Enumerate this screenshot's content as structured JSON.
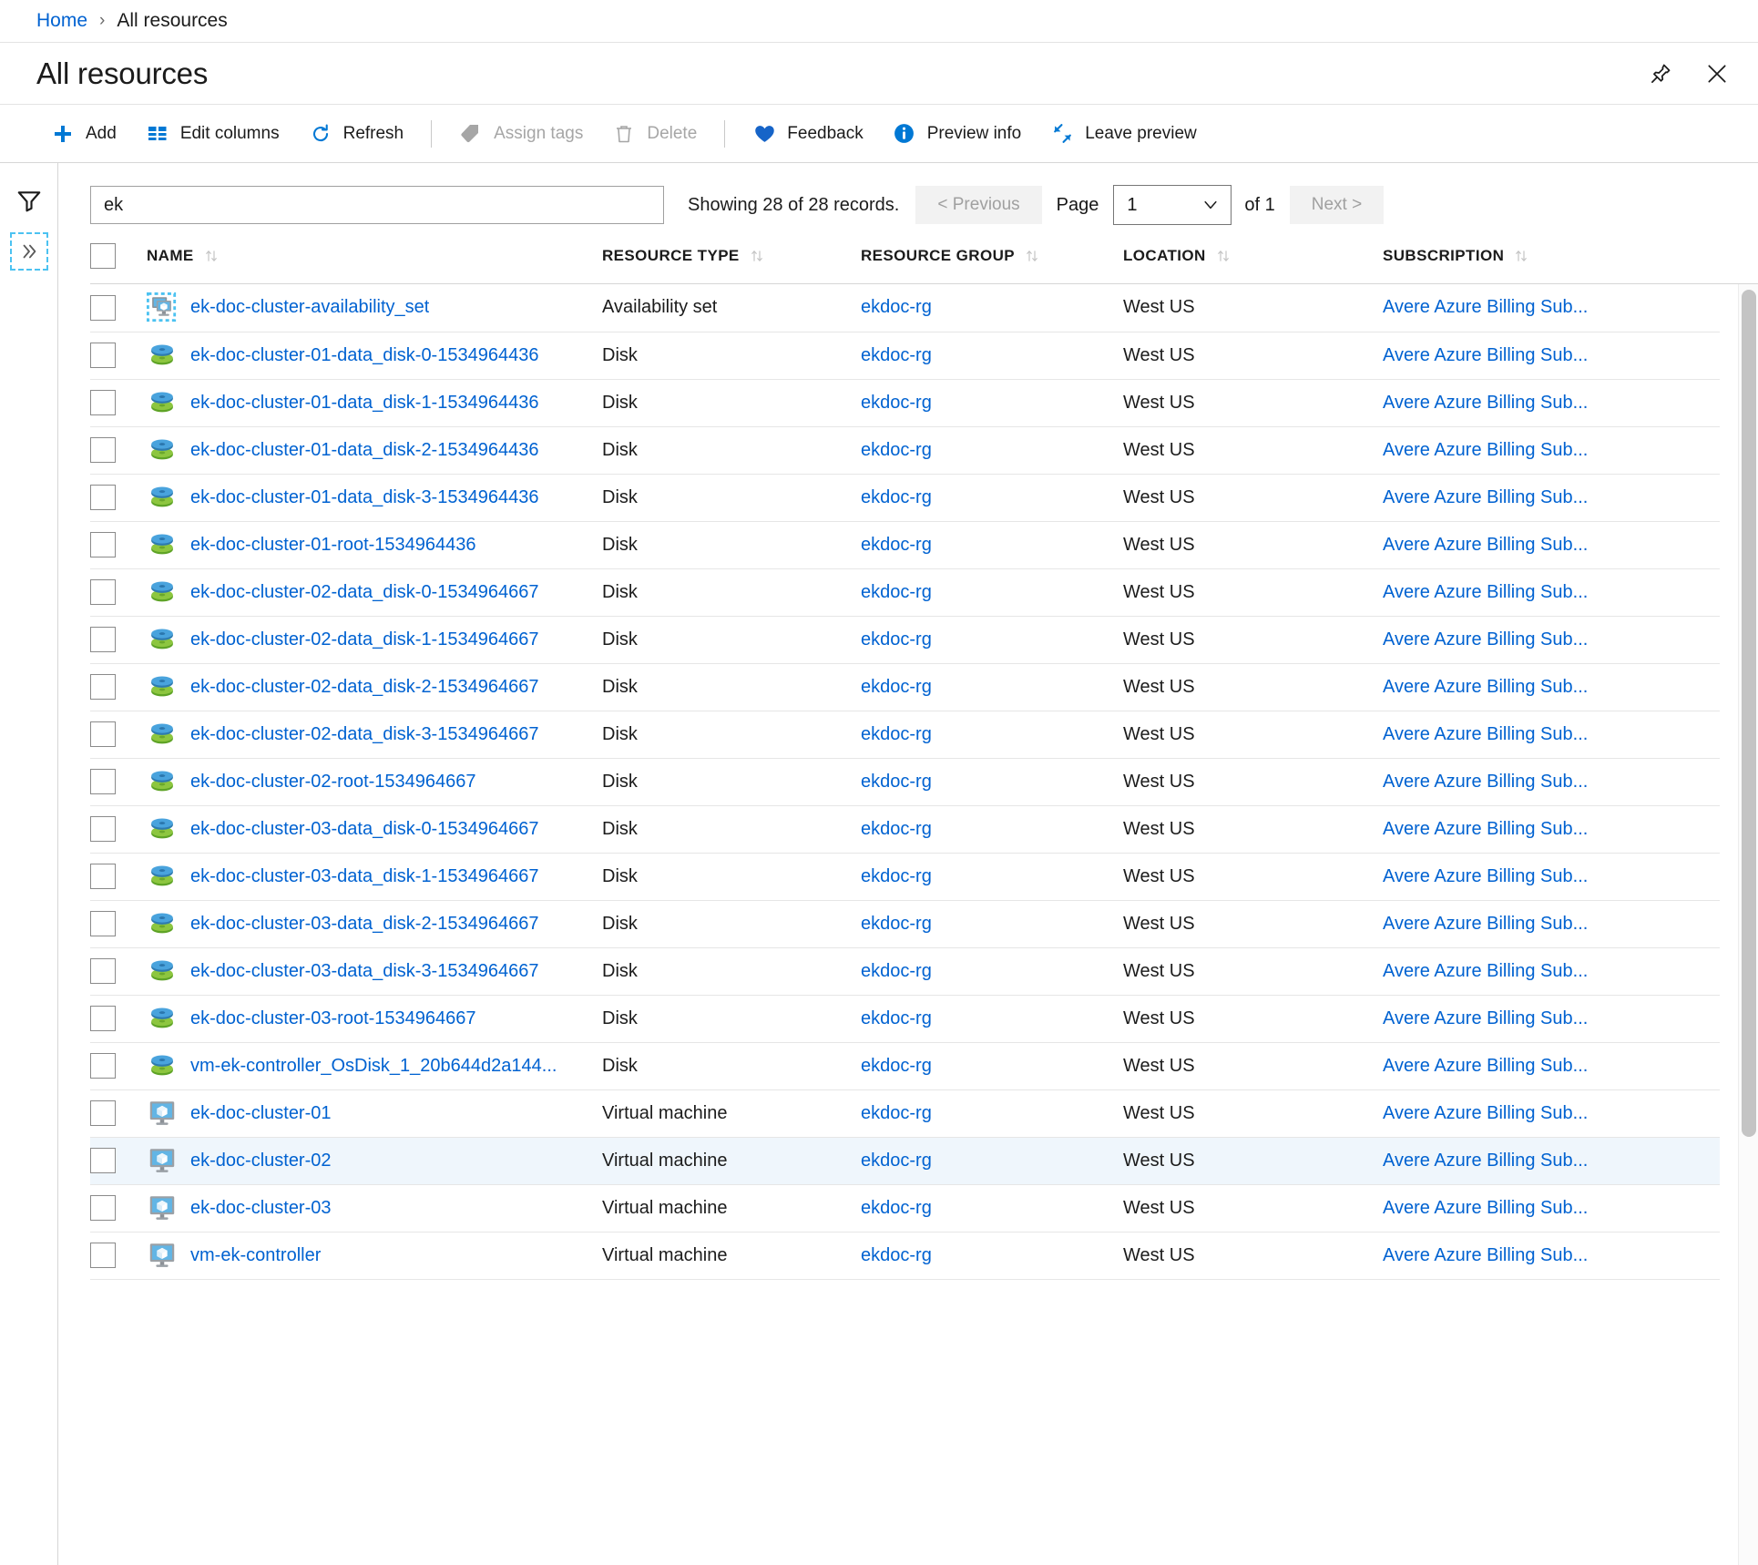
{
  "breadcrumb": {
    "home": "Home",
    "separator": "›",
    "current": "All resources"
  },
  "header": {
    "title": "All resources",
    "pin_icon": "pin-icon",
    "close_icon": "close-icon"
  },
  "toolbar": {
    "items": [
      {
        "label": "Add",
        "icon": "plus-icon",
        "disabled": false
      },
      {
        "label": "Edit columns",
        "icon": "columns-icon",
        "disabled": false
      },
      {
        "label": "Refresh",
        "icon": "refresh-icon",
        "disabled": false
      },
      {
        "label": "Assign tags",
        "icon": "tag-icon",
        "disabled": true
      },
      {
        "label": "Delete",
        "icon": "trash-icon",
        "disabled": true
      },
      {
        "label": "Feedback",
        "icon": "heart-icon",
        "disabled": false
      },
      {
        "label": "Preview info",
        "icon": "info-icon",
        "disabled": false
      },
      {
        "label": "Leave preview",
        "icon": "leave-preview-icon",
        "disabled": false
      }
    ]
  },
  "rail": {
    "filter_icon": "filter-funnel-icon",
    "expand_icon": "double-chevron-right-icon"
  },
  "search": {
    "value": "ek",
    "placeholder": ""
  },
  "pagination": {
    "records_text": "Showing 28 of 28 records.",
    "previous_label": "< Previous",
    "page_label": "Page",
    "page_value": "1",
    "of_label": "of 1",
    "next_label": "Next >"
  },
  "columns": [
    {
      "key": "name",
      "label": "NAME"
    },
    {
      "key": "type",
      "label": "RESOURCE TYPE"
    },
    {
      "key": "rg",
      "label": "RESOURCE GROUP"
    },
    {
      "key": "loc",
      "label": "LOCATION"
    },
    {
      "key": "sub",
      "label": "SUBSCRIPTION"
    }
  ],
  "colors": {
    "link": "#0062d1",
    "accent": "#0078d4",
    "selected_row": "#eff6fc"
  },
  "rows": [
    {
      "icon": "availability-set-icon",
      "name": "ek-doc-cluster-availability_set",
      "type": "Availability set",
      "rg": "ekdoc-rg",
      "loc": "West US",
      "sub": "Avere Azure Billing Sub...",
      "selected": false
    },
    {
      "icon": "disk-icon",
      "name": "ek-doc-cluster-01-data_disk-0-1534964436",
      "type": "Disk",
      "rg": "ekdoc-rg",
      "loc": "West US",
      "sub": "Avere Azure Billing Sub...",
      "selected": false
    },
    {
      "icon": "disk-icon",
      "name": "ek-doc-cluster-01-data_disk-1-1534964436",
      "type": "Disk",
      "rg": "ekdoc-rg",
      "loc": "West US",
      "sub": "Avere Azure Billing Sub...",
      "selected": false
    },
    {
      "icon": "disk-icon",
      "name": "ek-doc-cluster-01-data_disk-2-1534964436",
      "type": "Disk",
      "rg": "ekdoc-rg",
      "loc": "West US",
      "sub": "Avere Azure Billing Sub...",
      "selected": false
    },
    {
      "icon": "disk-icon",
      "name": "ek-doc-cluster-01-data_disk-3-1534964436",
      "type": "Disk",
      "rg": "ekdoc-rg",
      "loc": "West US",
      "sub": "Avere Azure Billing Sub...",
      "selected": false
    },
    {
      "icon": "disk-icon",
      "name": "ek-doc-cluster-01-root-1534964436",
      "type": "Disk",
      "rg": "ekdoc-rg",
      "loc": "West US",
      "sub": "Avere Azure Billing Sub...",
      "selected": false
    },
    {
      "icon": "disk-icon",
      "name": "ek-doc-cluster-02-data_disk-0-1534964667",
      "type": "Disk",
      "rg": "ekdoc-rg",
      "loc": "West US",
      "sub": "Avere Azure Billing Sub...",
      "selected": false
    },
    {
      "icon": "disk-icon",
      "name": "ek-doc-cluster-02-data_disk-1-1534964667",
      "type": "Disk",
      "rg": "ekdoc-rg",
      "loc": "West US",
      "sub": "Avere Azure Billing Sub...",
      "selected": false
    },
    {
      "icon": "disk-icon",
      "name": "ek-doc-cluster-02-data_disk-2-1534964667",
      "type": "Disk",
      "rg": "ekdoc-rg",
      "loc": "West US",
      "sub": "Avere Azure Billing Sub...",
      "selected": false
    },
    {
      "icon": "disk-icon",
      "name": "ek-doc-cluster-02-data_disk-3-1534964667",
      "type": "Disk",
      "rg": "ekdoc-rg",
      "loc": "West US",
      "sub": "Avere Azure Billing Sub...",
      "selected": false
    },
    {
      "icon": "disk-icon",
      "name": "ek-doc-cluster-02-root-1534964667",
      "type": "Disk",
      "rg": "ekdoc-rg",
      "loc": "West US",
      "sub": "Avere Azure Billing Sub...",
      "selected": false
    },
    {
      "icon": "disk-icon",
      "name": "ek-doc-cluster-03-data_disk-0-1534964667",
      "type": "Disk",
      "rg": "ekdoc-rg",
      "loc": "West US",
      "sub": "Avere Azure Billing Sub...",
      "selected": false
    },
    {
      "icon": "disk-icon",
      "name": "ek-doc-cluster-03-data_disk-1-1534964667",
      "type": "Disk",
      "rg": "ekdoc-rg",
      "loc": "West US",
      "sub": "Avere Azure Billing Sub...",
      "selected": false
    },
    {
      "icon": "disk-icon",
      "name": "ek-doc-cluster-03-data_disk-2-1534964667",
      "type": "Disk",
      "rg": "ekdoc-rg",
      "loc": "West US",
      "sub": "Avere Azure Billing Sub...",
      "selected": false
    },
    {
      "icon": "disk-icon",
      "name": "ek-doc-cluster-03-data_disk-3-1534964667",
      "type": "Disk",
      "rg": "ekdoc-rg",
      "loc": "West US",
      "sub": "Avere Azure Billing Sub...",
      "selected": false
    },
    {
      "icon": "disk-icon",
      "name": "ek-doc-cluster-03-root-1534964667",
      "type": "Disk",
      "rg": "ekdoc-rg",
      "loc": "West US",
      "sub": "Avere Azure Billing Sub...",
      "selected": false
    },
    {
      "icon": "disk-icon",
      "name": "vm-ek-controller_OsDisk_1_20b644d2a144...",
      "type": "Disk",
      "rg": "ekdoc-rg",
      "loc": "West US",
      "sub": "Avere Azure Billing Sub...",
      "selected": false
    },
    {
      "icon": "virtual-machine-icon",
      "name": "ek-doc-cluster-01",
      "type": "Virtual machine",
      "rg": "ekdoc-rg",
      "loc": "West US",
      "sub": "Avere Azure Billing Sub...",
      "selected": false
    },
    {
      "icon": "virtual-machine-icon",
      "name": "ek-doc-cluster-02",
      "type": "Virtual machine",
      "rg": "ekdoc-rg",
      "loc": "West US",
      "sub": "Avere Azure Billing Sub...",
      "selected": true
    },
    {
      "icon": "virtual-machine-icon",
      "name": "ek-doc-cluster-03",
      "type": "Virtual machine",
      "rg": "ekdoc-rg",
      "loc": "West US",
      "sub": "Avere Azure Billing Sub...",
      "selected": false
    },
    {
      "icon": "virtual-machine-icon",
      "name": "vm-ek-controller",
      "type": "Virtual machine",
      "rg": "ekdoc-rg",
      "loc": "West US",
      "sub": "Avere Azure Billing Sub...",
      "selected": false
    }
  ]
}
